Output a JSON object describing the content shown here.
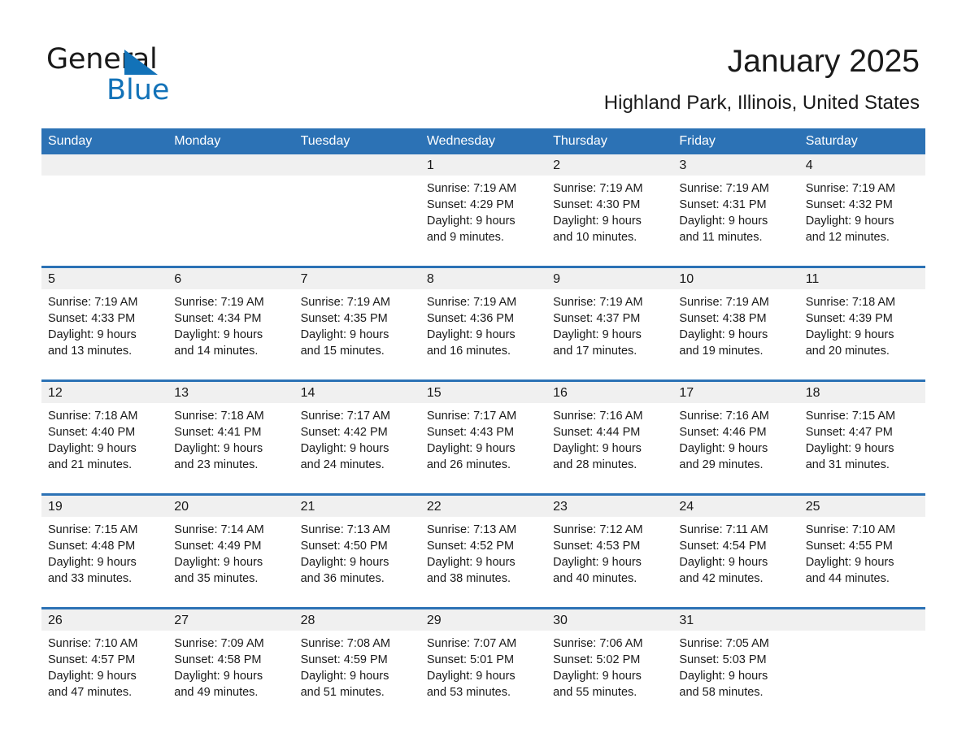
{
  "brand": {
    "name_part1": "General",
    "name_part2": "Blue",
    "triangle_color": "#1272b8",
    "logo_icon": "triangle-icon"
  },
  "header": {
    "title": "January 2025",
    "subtitle": "Highland Park, Illinois, United States"
  },
  "theme": {
    "header_blue": "#2c72b5",
    "band_gray": "#f0f0f0",
    "text": "#1a1a1a"
  },
  "calendar": {
    "weekday_headers": [
      "Sunday",
      "Monday",
      "Tuesday",
      "Wednesday",
      "Thursday",
      "Friday",
      "Saturday"
    ],
    "weeks": [
      [
        {
          "day": "",
          "empty": true
        },
        {
          "day": "",
          "empty": true
        },
        {
          "day": "",
          "empty": true
        },
        {
          "day": "1",
          "sunrise": "Sunrise: 7:19 AM",
          "sunset": "Sunset: 4:29 PM",
          "daylight_line1": "Daylight: 9 hours",
          "daylight_line2": "and 9 minutes."
        },
        {
          "day": "2",
          "sunrise": "Sunrise: 7:19 AM",
          "sunset": "Sunset: 4:30 PM",
          "daylight_line1": "Daylight: 9 hours",
          "daylight_line2": "and 10 minutes."
        },
        {
          "day": "3",
          "sunrise": "Sunrise: 7:19 AM",
          "sunset": "Sunset: 4:31 PM",
          "daylight_line1": "Daylight: 9 hours",
          "daylight_line2": "and 11 minutes."
        },
        {
          "day": "4",
          "sunrise": "Sunrise: 7:19 AM",
          "sunset": "Sunset: 4:32 PM",
          "daylight_line1": "Daylight: 9 hours",
          "daylight_line2": "and 12 minutes."
        }
      ],
      [
        {
          "day": "5",
          "sunrise": "Sunrise: 7:19 AM",
          "sunset": "Sunset: 4:33 PM",
          "daylight_line1": "Daylight: 9 hours",
          "daylight_line2": "and 13 minutes."
        },
        {
          "day": "6",
          "sunrise": "Sunrise: 7:19 AM",
          "sunset": "Sunset: 4:34 PM",
          "daylight_line1": "Daylight: 9 hours",
          "daylight_line2": "and 14 minutes."
        },
        {
          "day": "7",
          "sunrise": "Sunrise: 7:19 AM",
          "sunset": "Sunset: 4:35 PM",
          "daylight_line1": "Daylight: 9 hours",
          "daylight_line2": "and 15 minutes."
        },
        {
          "day": "8",
          "sunrise": "Sunrise: 7:19 AM",
          "sunset": "Sunset: 4:36 PM",
          "daylight_line1": "Daylight: 9 hours",
          "daylight_line2": "and 16 minutes."
        },
        {
          "day": "9",
          "sunrise": "Sunrise: 7:19 AM",
          "sunset": "Sunset: 4:37 PM",
          "daylight_line1": "Daylight: 9 hours",
          "daylight_line2": "and 17 minutes."
        },
        {
          "day": "10",
          "sunrise": "Sunrise: 7:19 AM",
          "sunset": "Sunset: 4:38 PM",
          "daylight_line1": "Daylight: 9 hours",
          "daylight_line2": "and 19 minutes."
        },
        {
          "day": "11",
          "sunrise": "Sunrise: 7:18 AM",
          "sunset": "Sunset: 4:39 PM",
          "daylight_line1": "Daylight: 9 hours",
          "daylight_line2": "and 20 minutes."
        }
      ],
      [
        {
          "day": "12",
          "sunrise": "Sunrise: 7:18 AM",
          "sunset": "Sunset: 4:40 PM",
          "daylight_line1": "Daylight: 9 hours",
          "daylight_line2": "and 21 minutes."
        },
        {
          "day": "13",
          "sunrise": "Sunrise: 7:18 AM",
          "sunset": "Sunset: 4:41 PM",
          "daylight_line1": "Daylight: 9 hours",
          "daylight_line2": "and 23 minutes."
        },
        {
          "day": "14",
          "sunrise": "Sunrise: 7:17 AM",
          "sunset": "Sunset: 4:42 PM",
          "daylight_line1": "Daylight: 9 hours",
          "daylight_line2": "and 24 minutes."
        },
        {
          "day": "15",
          "sunrise": "Sunrise: 7:17 AM",
          "sunset": "Sunset: 4:43 PM",
          "daylight_line1": "Daylight: 9 hours",
          "daylight_line2": "and 26 minutes."
        },
        {
          "day": "16",
          "sunrise": "Sunrise: 7:16 AM",
          "sunset": "Sunset: 4:44 PM",
          "daylight_line1": "Daylight: 9 hours",
          "daylight_line2": "and 28 minutes."
        },
        {
          "day": "17",
          "sunrise": "Sunrise: 7:16 AM",
          "sunset": "Sunset: 4:46 PM",
          "daylight_line1": "Daylight: 9 hours",
          "daylight_line2": "and 29 minutes."
        },
        {
          "day": "18",
          "sunrise": "Sunrise: 7:15 AM",
          "sunset": "Sunset: 4:47 PM",
          "daylight_line1": "Daylight: 9 hours",
          "daylight_line2": "and 31 minutes."
        }
      ],
      [
        {
          "day": "19",
          "sunrise": "Sunrise: 7:15 AM",
          "sunset": "Sunset: 4:48 PM",
          "daylight_line1": "Daylight: 9 hours",
          "daylight_line2": "and 33 minutes."
        },
        {
          "day": "20",
          "sunrise": "Sunrise: 7:14 AM",
          "sunset": "Sunset: 4:49 PM",
          "daylight_line1": "Daylight: 9 hours",
          "daylight_line2": "and 35 minutes."
        },
        {
          "day": "21",
          "sunrise": "Sunrise: 7:13 AM",
          "sunset": "Sunset: 4:50 PM",
          "daylight_line1": "Daylight: 9 hours",
          "daylight_line2": "and 36 minutes."
        },
        {
          "day": "22",
          "sunrise": "Sunrise: 7:13 AM",
          "sunset": "Sunset: 4:52 PM",
          "daylight_line1": "Daylight: 9 hours",
          "daylight_line2": "and 38 minutes."
        },
        {
          "day": "23",
          "sunrise": "Sunrise: 7:12 AM",
          "sunset": "Sunset: 4:53 PM",
          "daylight_line1": "Daylight: 9 hours",
          "daylight_line2": "and 40 minutes."
        },
        {
          "day": "24",
          "sunrise": "Sunrise: 7:11 AM",
          "sunset": "Sunset: 4:54 PM",
          "daylight_line1": "Daylight: 9 hours",
          "daylight_line2": "and 42 minutes."
        },
        {
          "day": "25",
          "sunrise": "Sunrise: 7:10 AM",
          "sunset": "Sunset: 4:55 PM",
          "daylight_line1": "Daylight: 9 hours",
          "daylight_line2": "and 44 minutes."
        }
      ],
      [
        {
          "day": "26",
          "sunrise": "Sunrise: 7:10 AM",
          "sunset": "Sunset: 4:57 PM",
          "daylight_line1": "Daylight: 9 hours",
          "daylight_line2": "and 47 minutes."
        },
        {
          "day": "27",
          "sunrise": "Sunrise: 7:09 AM",
          "sunset": "Sunset: 4:58 PM",
          "daylight_line1": "Daylight: 9 hours",
          "daylight_line2": "and 49 minutes."
        },
        {
          "day": "28",
          "sunrise": "Sunrise: 7:08 AM",
          "sunset": "Sunset: 4:59 PM",
          "daylight_line1": "Daylight: 9 hours",
          "daylight_line2": "and 51 minutes."
        },
        {
          "day": "29",
          "sunrise": "Sunrise: 7:07 AM",
          "sunset": "Sunset: 5:01 PM",
          "daylight_line1": "Daylight: 9 hours",
          "daylight_line2": "and 53 minutes."
        },
        {
          "day": "30",
          "sunrise": "Sunrise: 7:06 AM",
          "sunset": "Sunset: 5:02 PM",
          "daylight_line1": "Daylight: 9 hours",
          "daylight_line2": "and 55 minutes."
        },
        {
          "day": "31",
          "sunrise": "Sunrise: 7:05 AM",
          "sunset": "Sunset: 5:03 PM",
          "daylight_line1": "Daylight: 9 hours",
          "daylight_line2": "and 58 minutes."
        },
        {
          "day": "",
          "empty": true
        }
      ]
    ]
  }
}
